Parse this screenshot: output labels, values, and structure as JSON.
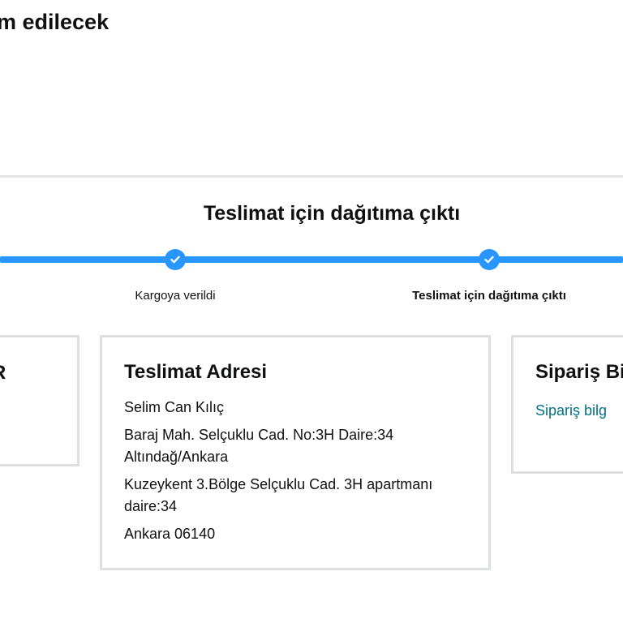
{
  "header": {
    "delivery_heading": "m edilecek"
  },
  "tracker": {
    "status_title": "Teslimat için dağıtıma çıktı",
    "steps": [
      {
        "label": "Kargoya verildi"
      },
      {
        "label": "Teslimat için dağıtıma çıktı"
      }
    ],
    "accent_color": "#2796ff"
  },
  "cards": {
    "left": {
      "title": "R"
    },
    "address": {
      "title": "Teslimat Adresi",
      "name": "Selim Can Kılıç",
      "line1": "Baraj Mah. Selçuklu Cad. No:3H Daire:34 Altındağ/Ankara",
      "line2": "Kuzeykent 3.Bölge Selçuklu Cad. 3H apartmanı daire:34",
      "city": "Ankara 06140"
    },
    "order": {
      "title": "Sipariş Bi",
      "link": "Sipariş bilg"
    }
  }
}
